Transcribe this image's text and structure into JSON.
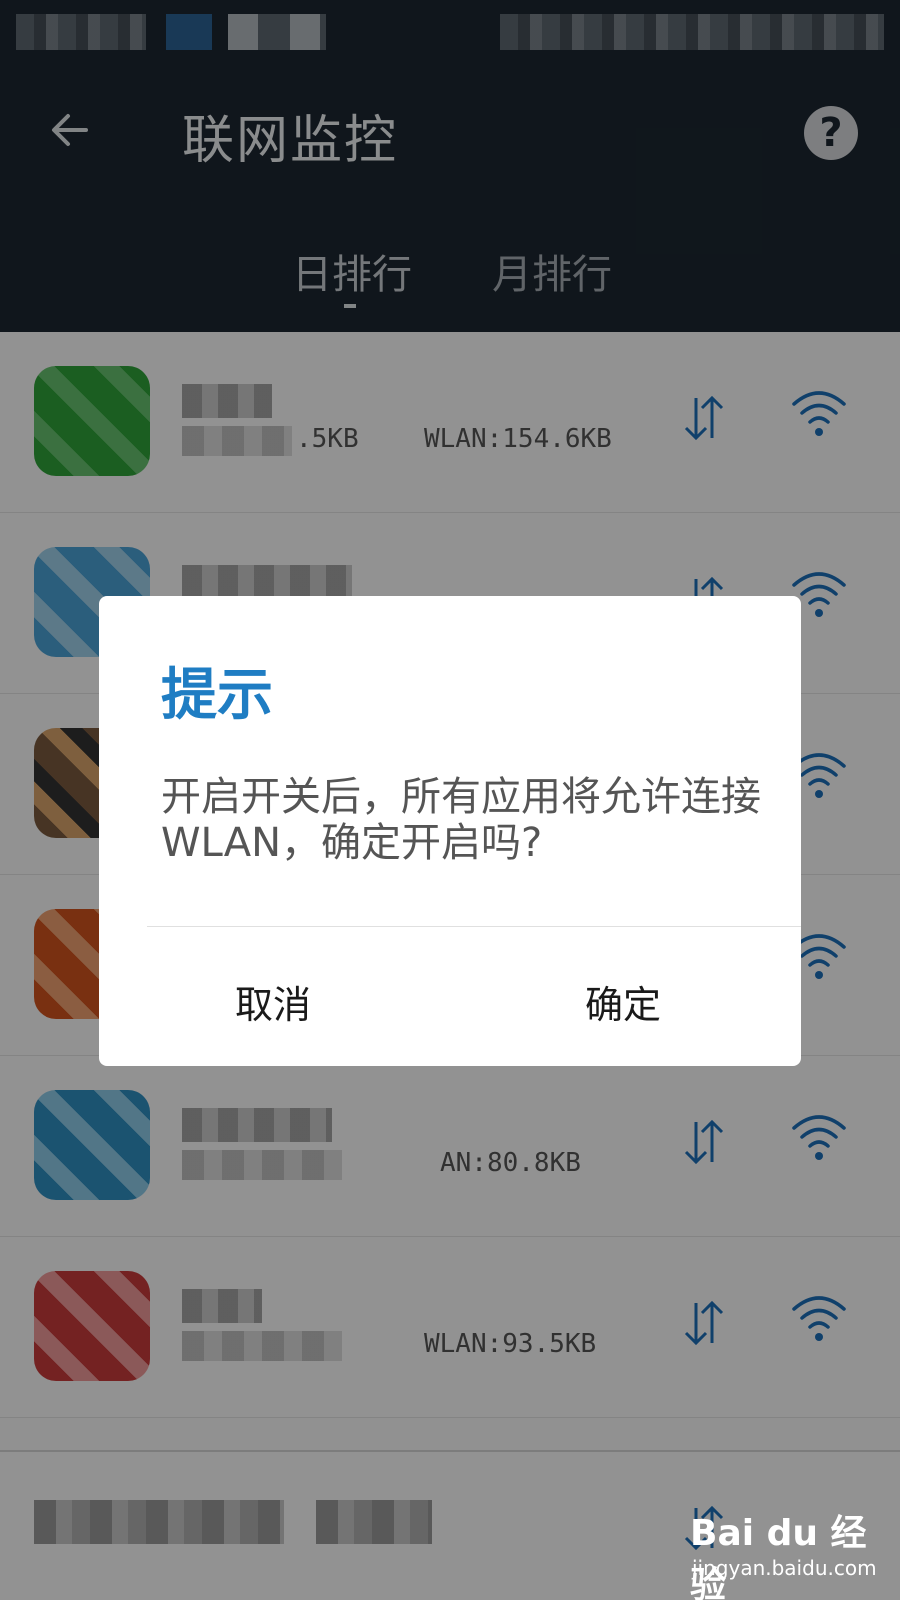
{
  "app_bar": {
    "title": "联网监控",
    "help_symbol": "?"
  },
  "tabs": [
    {
      "label": "日排行",
      "selected": true
    },
    {
      "label": "月排行",
      "selected": false
    }
  ],
  "list": [
    {
      "mobile": ".5KB",
      "wlan": "WLAN:154.6KB",
      "icon_color": "#2fa33a"
    },
    {
      "mobile": "",
      "wlan": "",
      "icon_color": "#4aa3d6"
    },
    {
      "mobile": "",
      "wlan": "",
      "icon_color": "#7a5b3e"
    },
    {
      "mobile": "",
      "wlan": "",
      "icon_color": "#d0541e"
    },
    {
      "mobile": "",
      "wlan": "AN:80.8KB",
      "icon_color": "#2f8fc2"
    },
    {
      "mobile": "",
      "wlan": "WLAN:93.5KB",
      "icon_color": "#c93c3c"
    }
  ],
  "dialog": {
    "title": "提示",
    "message": "开启开关后，所有应用将允许连接WLAN，确定开启吗?",
    "cancel_label": "取消",
    "ok_label": "确定"
  },
  "watermark": {
    "logo": "Bai du 经验",
    "url": "jingyan.baidu.com"
  },
  "colors": {
    "app_bar": "#1c2731",
    "accent": "#1f7dc3",
    "icon_blue": "#1d6fb8"
  }
}
